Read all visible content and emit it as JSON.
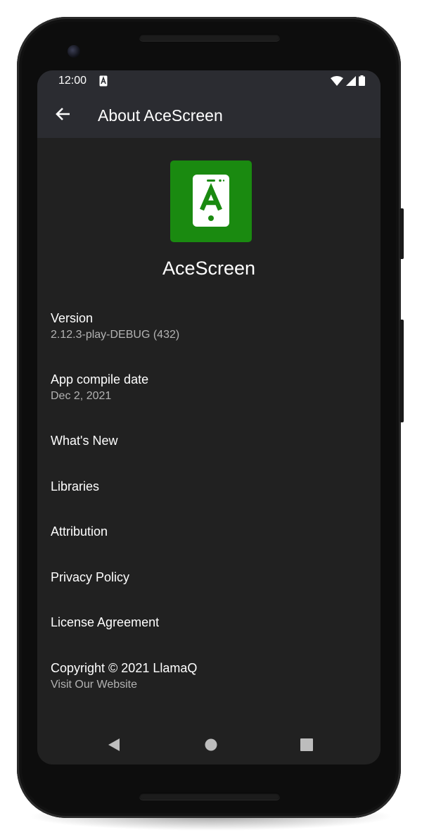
{
  "status_bar": {
    "time": "12:00",
    "app_notification_icon": "acescreen-icon",
    "wifi_icon": "wifi-icon",
    "signal_icon": "cell-signal-icon",
    "battery_icon": "battery-icon"
  },
  "app_bar": {
    "back_icon": "arrow-back-icon",
    "title": "About AceScreen"
  },
  "app": {
    "name": "AceScreen",
    "logo_color": "#1a8a10",
    "logo_letter": "A"
  },
  "items": [
    {
      "primary": "Version",
      "secondary": "2.12.3-play-DEBUG (432)"
    },
    {
      "primary": "App compile date",
      "secondary": "Dec 2, 2021"
    },
    {
      "primary": "What's New"
    },
    {
      "primary": "Libraries"
    },
    {
      "primary": "Attribution"
    },
    {
      "primary": "Privacy Policy"
    },
    {
      "primary": "License Agreement"
    },
    {
      "primary": "Copyright © 2021 LlamaQ",
      "secondary": "Visit Our Website"
    }
  ],
  "nav_bar": {
    "back": "nav-back-icon",
    "home": "nav-home-icon",
    "recents": "nav-recents-icon"
  },
  "colors": {
    "background": "#212121",
    "app_bar": "#2b2c31",
    "text_primary": "#ffffff",
    "text_secondary": "#b3b3b3",
    "accent_green": "#1a8a10"
  }
}
